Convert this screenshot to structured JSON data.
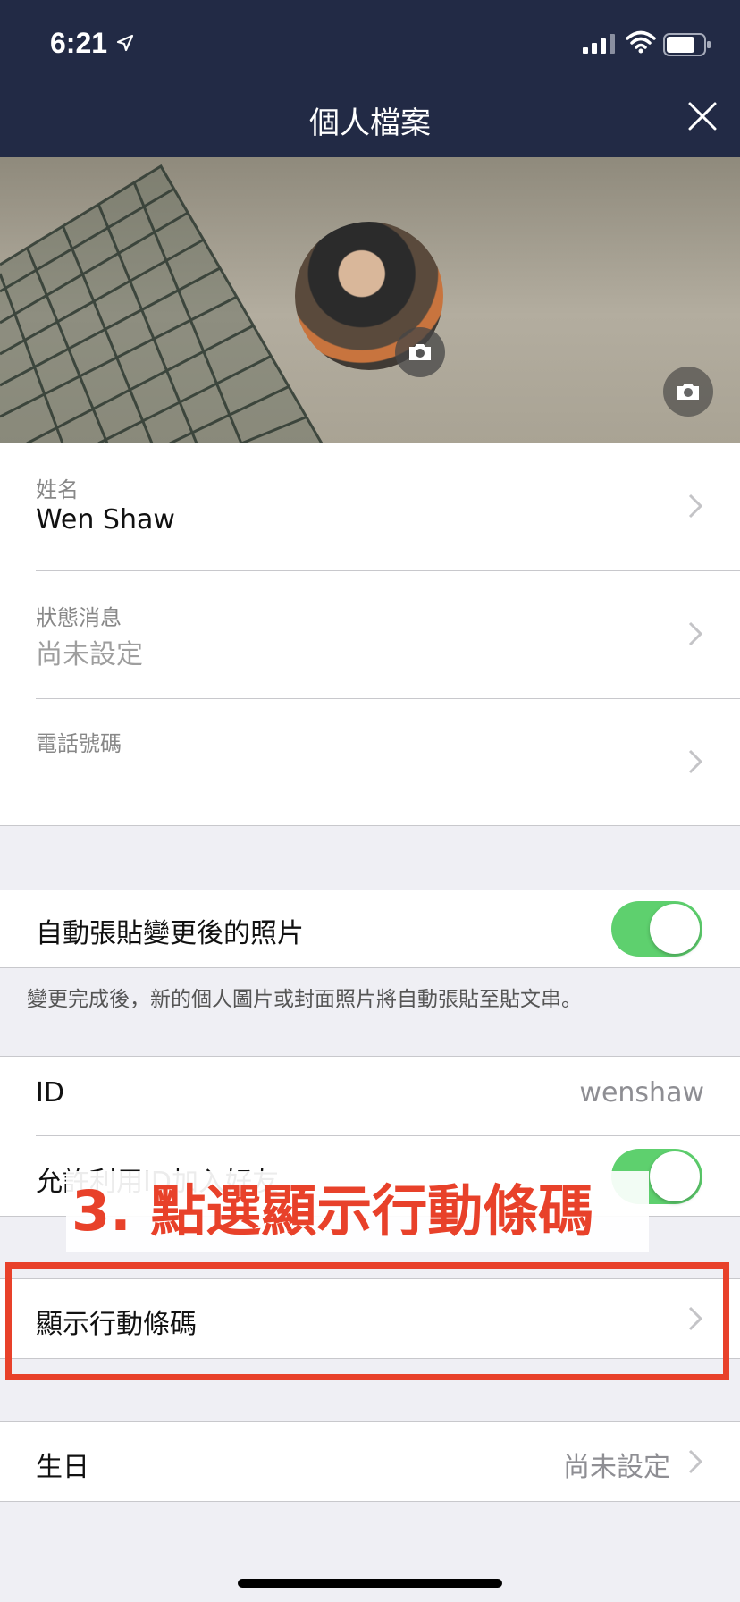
{
  "status_bar": {
    "time": "6:21"
  },
  "nav": {
    "title": "個人檔案"
  },
  "profile": {
    "name_label": "姓名",
    "name_value": "Wen Shaw",
    "status_label": "狀態消息",
    "status_value": "尚未設定",
    "phone_label": "電話號碼",
    "phone_value": ""
  },
  "auto_post": {
    "label": "自動張貼變更後的照片",
    "enabled": true,
    "footnote": "變更完成後，新的個人圖片或封面照片將自動張貼至貼文串。"
  },
  "id_section": {
    "id_label": "ID",
    "id_value": "wenshaw",
    "allow_label": "允許利用ID加入好友",
    "allow_enabled": true
  },
  "qr": {
    "label": "顯示行動條碼"
  },
  "birthday": {
    "label": "生日",
    "value": "尚未設定"
  },
  "annotation": {
    "text": "3. 點選顯示行動條碼",
    "color": "#e8412a"
  },
  "colors": {
    "header_bg": "#222a45",
    "toggle_on": "#5ed06e"
  }
}
